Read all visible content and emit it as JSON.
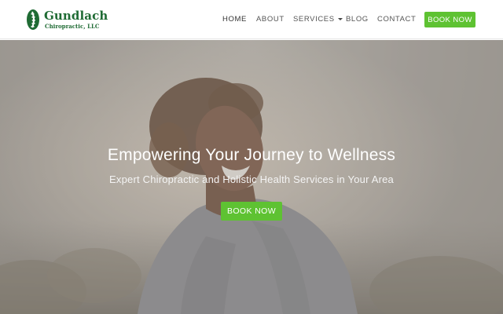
{
  "brand": {
    "name": "Gundlach",
    "subtitle": "Chiropractic, LLC",
    "color": "#1f6b34"
  },
  "nav": {
    "items": [
      {
        "label": "HOME",
        "active": true
      },
      {
        "label": "ABOUT"
      },
      {
        "label": "SERVICES",
        "has_dropdown": true
      },
      {
        "label": "BLOG"
      },
      {
        "label": "CONTACT"
      }
    ],
    "book_label": "BOOK NOW"
  },
  "hero": {
    "title": "Empowering Your Journey to Wellness",
    "subtitle": "Expert Chiropractic and Holistic Health Services in Your Area",
    "cta_label": "BOOK NOW"
  },
  "colors": {
    "accent": "#5ec232",
    "overlay": "#8f8a84"
  },
  "icons": [
    "spine-logo-icon",
    "chevron-down-icon"
  ]
}
